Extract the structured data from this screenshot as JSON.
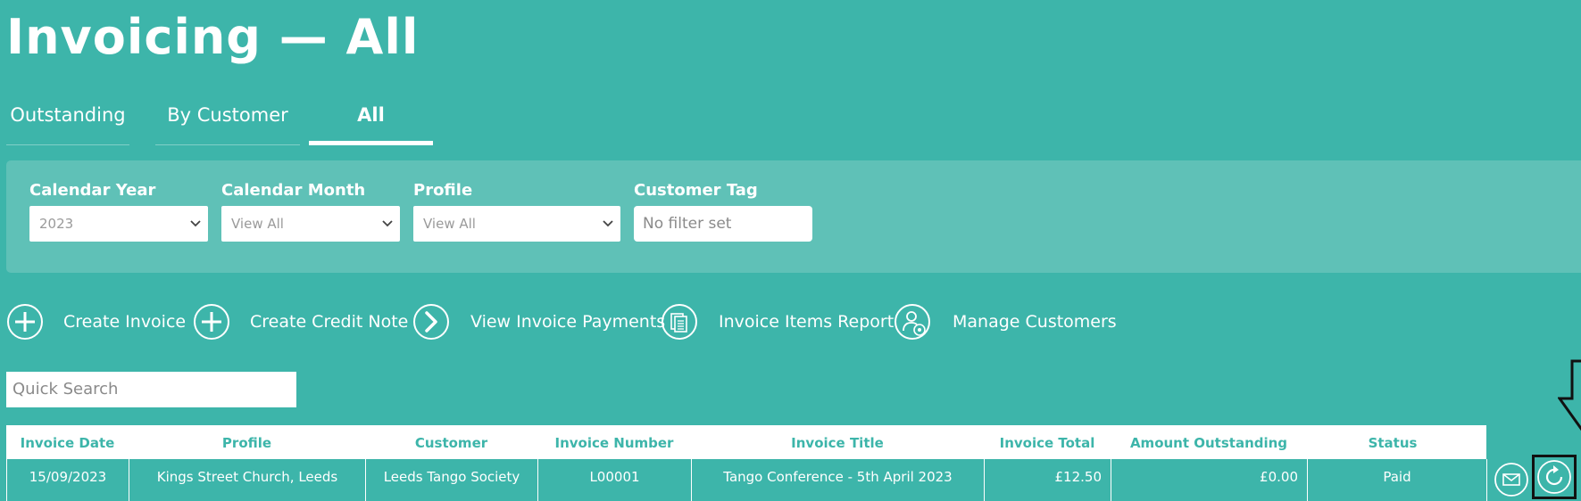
{
  "page": {
    "title": "Invoicing — All"
  },
  "tabs": [
    {
      "label": "Outstanding",
      "active": false
    },
    {
      "label": "By Customer",
      "active": false
    },
    {
      "label": "All",
      "active": true
    }
  ],
  "filters": {
    "calendar_year": {
      "label": "Calendar Year",
      "value": "2023"
    },
    "calendar_month": {
      "label": "Calendar Month",
      "value": "View All"
    },
    "profile": {
      "label": "Profile",
      "value": "View All"
    },
    "customer_tag": {
      "label": "Customer Tag",
      "placeholder": "No filter set"
    }
  },
  "actions": [
    {
      "label": "Create Invoice",
      "icon": "plus-circle-icon"
    },
    {
      "label": "Create Credit Note",
      "icon": "plus-circle-icon"
    },
    {
      "label": "View Invoice Payments",
      "icon": "chevron-right-circle-icon"
    },
    {
      "label": "Invoice Items Report",
      "icon": "document-stack-icon"
    },
    {
      "label": "Manage Customers",
      "icon": "user-settings-icon"
    }
  ],
  "search": {
    "placeholder": "Quick Search"
  },
  "table": {
    "columns": [
      "Invoice Date",
      "Profile",
      "Customer",
      "Invoice Number",
      "Invoice Title",
      "Invoice Total",
      "Amount Outstanding",
      "Status"
    ],
    "rows": [
      {
        "invoice_date": "15/09/2023",
        "profile": "Kings Street Church, Leeds",
        "customer": "Leeds Tango Society",
        "invoice_number": "L00001",
        "invoice_title": "Tango Conference - 5th April 2023",
        "invoice_total": "£12.50",
        "amount_outstanding": "£0.00",
        "status": "Paid"
      }
    ],
    "row_actions": [
      "envelope-icon",
      "refresh-icon"
    ]
  },
  "colors": {
    "background": "#3db5aa",
    "panel": "#5fc1b7",
    "header_text": "#3db5aa",
    "annotation": "#111111"
  }
}
